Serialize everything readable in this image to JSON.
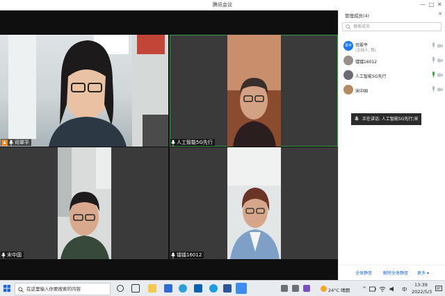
{
  "window": {
    "title": "腾讯会议"
  },
  "tiles": [
    {
      "name": "司翠平",
      "is_host": true,
      "active": false
    },
    {
      "name": "人工智能5G先行",
      "is_host": false,
      "active": true
    },
    {
      "name": "宋中国",
      "is_host": false,
      "active": false
    },
    {
      "name": "镭镭16012",
      "is_host": false,
      "active": false
    }
  ],
  "panel": {
    "title": "管理成员(4)",
    "search_placeholder": "搜索成员",
    "members": [
      {
        "name": "司翠平",
        "role": "(主持人, 我)",
        "avatar_text": "翠平",
        "mic_color": "#b6bcc4"
      },
      {
        "name": "镭镭16012",
        "role": "",
        "avatar_text": "",
        "mic_color": "#b6bcc4"
      },
      {
        "name": "人工智能5G先行",
        "role": "",
        "avatar_text": "",
        "mic_color": "#2fb344"
      },
      {
        "name": "宋中国",
        "role": "",
        "avatar_text": "",
        "mic_color": "#b6bcc4"
      }
    ],
    "speaking_tooltip": "正在讲话: 人工智能5G先行;宋",
    "footer": {
      "mute_all": "全体静音",
      "unmute_all": "解除全体静音",
      "more": "更多"
    }
  },
  "taskbar": {
    "search_placeholder": "在这里输入你要搜索的内容",
    "weather": "24°C 晴朗",
    "ime": "中",
    "time": "13:39",
    "date": "2022/5/3"
  },
  "colors": {
    "accent": "#1a66d9",
    "active_border": "#2ea043",
    "host_badge": "#f08c24",
    "speaking_mic": "#2fb344"
  }
}
